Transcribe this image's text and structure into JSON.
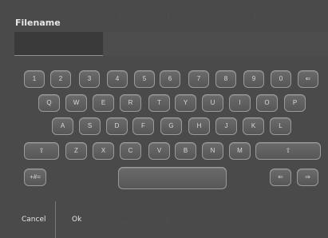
{
  "dialog": {
    "title": "Filename",
    "filename_value": "",
    "cancel_label": "Cancel",
    "ok_label": "Ok"
  },
  "keyboard": {
    "rows": [
      [
        "1",
        "2",
        "3",
        "4",
        "5",
        "6",
        "7",
        "8",
        "9",
        "0",
        "⇐"
      ],
      [
        "Q",
        "W",
        "E",
        "R",
        "T",
        "Y",
        "U",
        "I",
        "O",
        "P"
      ],
      [
        "A",
        "S",
        "D",
        "F",
        "G",
        "H",
        "J",
        "K",
        "L"
      ],
      [
        "⇧",
        "Z",
        "X",
        "C",
        "V",
        "B",
        "N",
        "M",
        "⇧"
      ],
      [
        "+#=",
        "",
        "⇐",
        "⇒"
      ]
    ]
  },
  "colors": {
    "dialog_bg": "#4a4a4a",
    "key_border": "#9a9a9a",
    "text": "#e6e6e6"
  }
}
